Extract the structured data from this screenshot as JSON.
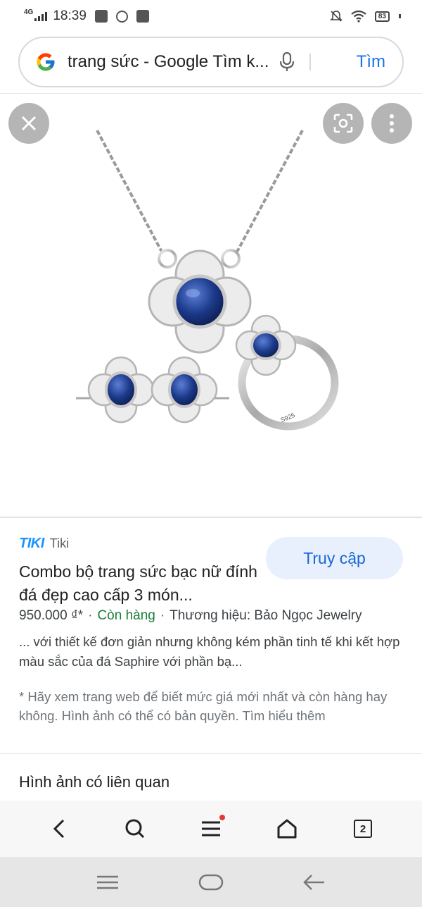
{
  "status_bar": {
    "network": "4G",
    "time": "18:39",
    "battery": "83"
  },
  "search": {
    "query": "trang sức - Google Tìm k...",
    "button": "Tìm"
  },
  "result": {
    "source": "Tiki",
    "source_logo_text": "TIKI",
    "visit_button": "Truy cập",
    "title": "Combo bộ trang sức bạc nữ đính đá đẹp cao cấp 3 món...",
    "price": "950.000 ₫*",
    "stock": "Còn hàng",
    "brand": "Thương hiệu: Bảo Ngọc Jewelry",
    "description": "... với thiết kế đơn giản nhưng không kém phần tinh tế khi kết hợp màu sắc của đá Saphire với phần bạ...",
    "disclaimer": "* Hãy xem trang web để biết mức giá mới nhất và còn hàng hay không. Hình ảnh có thể có bản quyền. Tìm hiểu thêm",
    "ring_engraving": "S925"
  },
  "related_heading": "Hình ảnh có liên quan",
  "browser_bar": {
    "tab_count": "2"
  },
  "colors": {
    "accent": "#1a73e8",
    "visit_bg": "#e8f0fe",
    "in_stock": "#188038",
    "sapphire": "#1c3a8a"
  }
}
